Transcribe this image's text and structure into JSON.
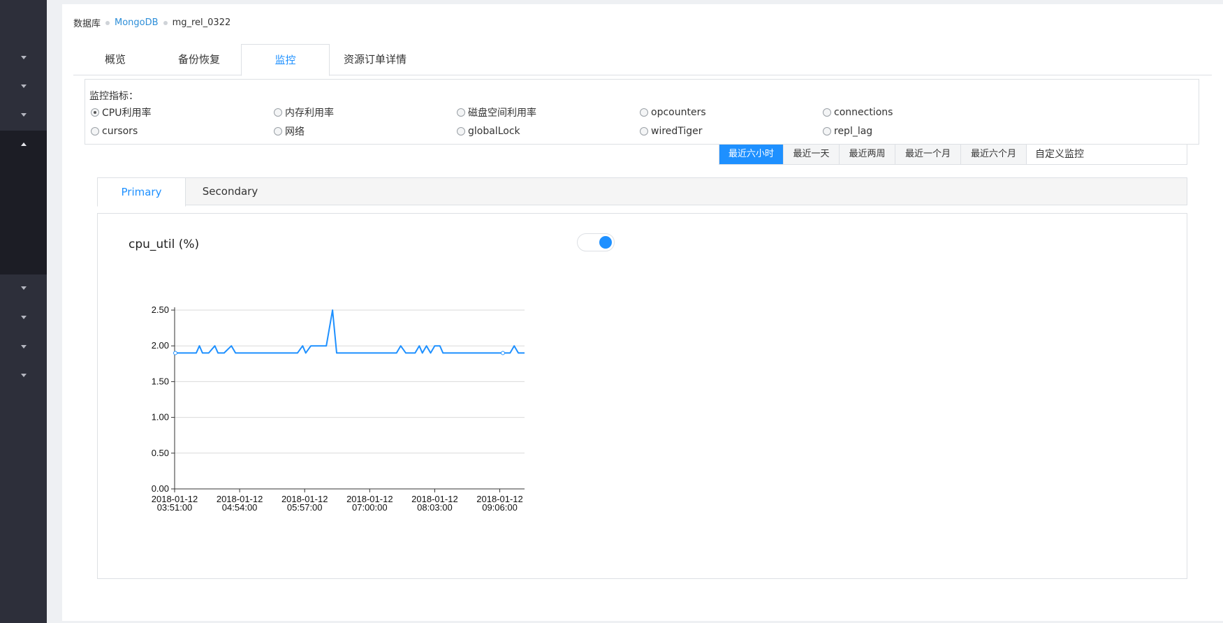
{
  "breadcrumb": [
    {
      "label": "数据库",
      "link": false
    },
    {
      "label": "MongoDB",
      "link": true
    },
    {
      "label": "mg_rel_0322",
      "link": false
    }
  ],
  "tabs": [
    {
      "label": "概览",
      "active": false
    },
    {
      "label": "备份恢复",
      "active": false
    },
    {
      "label": "监控",
      "active": true
    },
    {
      "label": "资源订单详情",
      "active": false
    }
  ],
  "metrics": {
    "label": "监控指标：",
    "options": [
      {
        "label": "CPU利用率",
        "checked": true
      },
      {
        "label": "内存利用率",
        "checked": false
      },
      {
        "label": "磁盘空间利用率",
        "checked": false
      },
      {
        "label": "opcounters",
        "checked": false
      },
      {
        "label": "connections",
        "checked": false
      },
      {
        "label": "cursors",
        "checked": false
      },
      {
        "label": "网络",
        "checked": false
      },
      {
        "label": "globalLock",
        "checked": false
      },
      {
        "label": "wiredTiger",
        "checked": false
      },
      {
        "label": "repl_lag",
        "checked": false
      }
    ]
  },
  "time_range": {
    "options": [
      "最近六小时",
      "最近一天",
      "最近两周",
      "最近一个月",
      "最近六个月"
    ],
    "active": "最近六小时",
    "custom": "自定义监控"
  },
  "subtabs": [
    {
      "label": "Primary",
      "active": true
    },
    {
      "label": "Secondary",
      "active": false
    }
  ],
  "chart": {
    "title": "cpu_util (%)",
    "toggle_on": true
  },
  "colors": {
    "accent": "#1e90ff",
    "sidebar": "#2d2f3a",
    "sidebar_active": "#1c1d25"
  },
  "chart_data": {
    "type": "line",
    "title": "cpu_util (%)",
    "xlabel": "",
    "ylabel": "",
    "ylim": [
      0,
      2.5
    ],
    "y_ticks": [
      "0.00",
      "0.50",
      "1.00",
      "1.50",
      "2.00",
      "2.50"
    ],
    "x_ticks": [
      {
        "date": "2018-01-12",
        "time": "03:51:00"
      },
      {
        "date": "2018-01-12",
        "time": "04:54:00"
      },
      {
        "date": "2018-01-12",
        "time": "05:57:00"
      },
      {
        "date": "2018-01-12",
        "time": "07:00:00"
      },
      {
        "date": "2018-01-12",
        "time": "08:03:00"
      },
      {
        "date": "2018-01-12",
        "time": "09:06:00"
      }
    ],
    "grid": true,
    "series": [
      {
        "color": "#1e90ff",
        "points": [
          [
            "03:51",
            1.9
          ],
          [
            "03:57",
            1.9
          ],
          [
            "04:12",
            1.9
          ],
          [
            "04:15",
            2.0
          ],
          [
            "04:18",
            1.9
          ],
          [
            "04:24",
            1.9
          ],
          [
            "04:30",
            2.0
          ],
          [
            "04:33",
            1.9
          ],
          [
            "04:39",
            1.9
          ],
          [
            "04:46",
            2.0
          ],
          [
            "04:50",
            1.9
          ],
          [
            "05:50",
            1.9
          ],
          [
            "05:55",
            2.0
          ],
          [
            "05:58",
            1.9
          ],
          [
            "06:03",
            2.0
          ],
          [
            "06:15",
            2.0
          ],
          [
            "06:18",
            2.0
          ],
          [
            "06:24",
            2.5
          ],
          [
            "06:28",
            1.9
          ],
          [
            "07:26",
            1.9
          ],
          [
            "07:30",
            2.0
          ],
          [
            "07:35",
            1.9
          ],
          [
            "07:44",
            1.9
          ],
          [
            "07:48",
            2.0
          ],
          [
            "07:51",
            1.9
          ],
          [
            "07:55",
            2.0
          ],
          [
            "07:59",
            1.9
          ],
          [
            "08:03",
            2.0
          ],
          [
            "08:08",
            2.0
          ],
          [
            "08:11",
            1.9
          ],
          [
            "09:16",
            1.9
          ],
          [
            "09:20",
            2.0
          ],
          [
            "09:24",
            1.9
          ],
          [
            "09:30",
            1.9
          ]
        ]
      }
    ]
  }
}
